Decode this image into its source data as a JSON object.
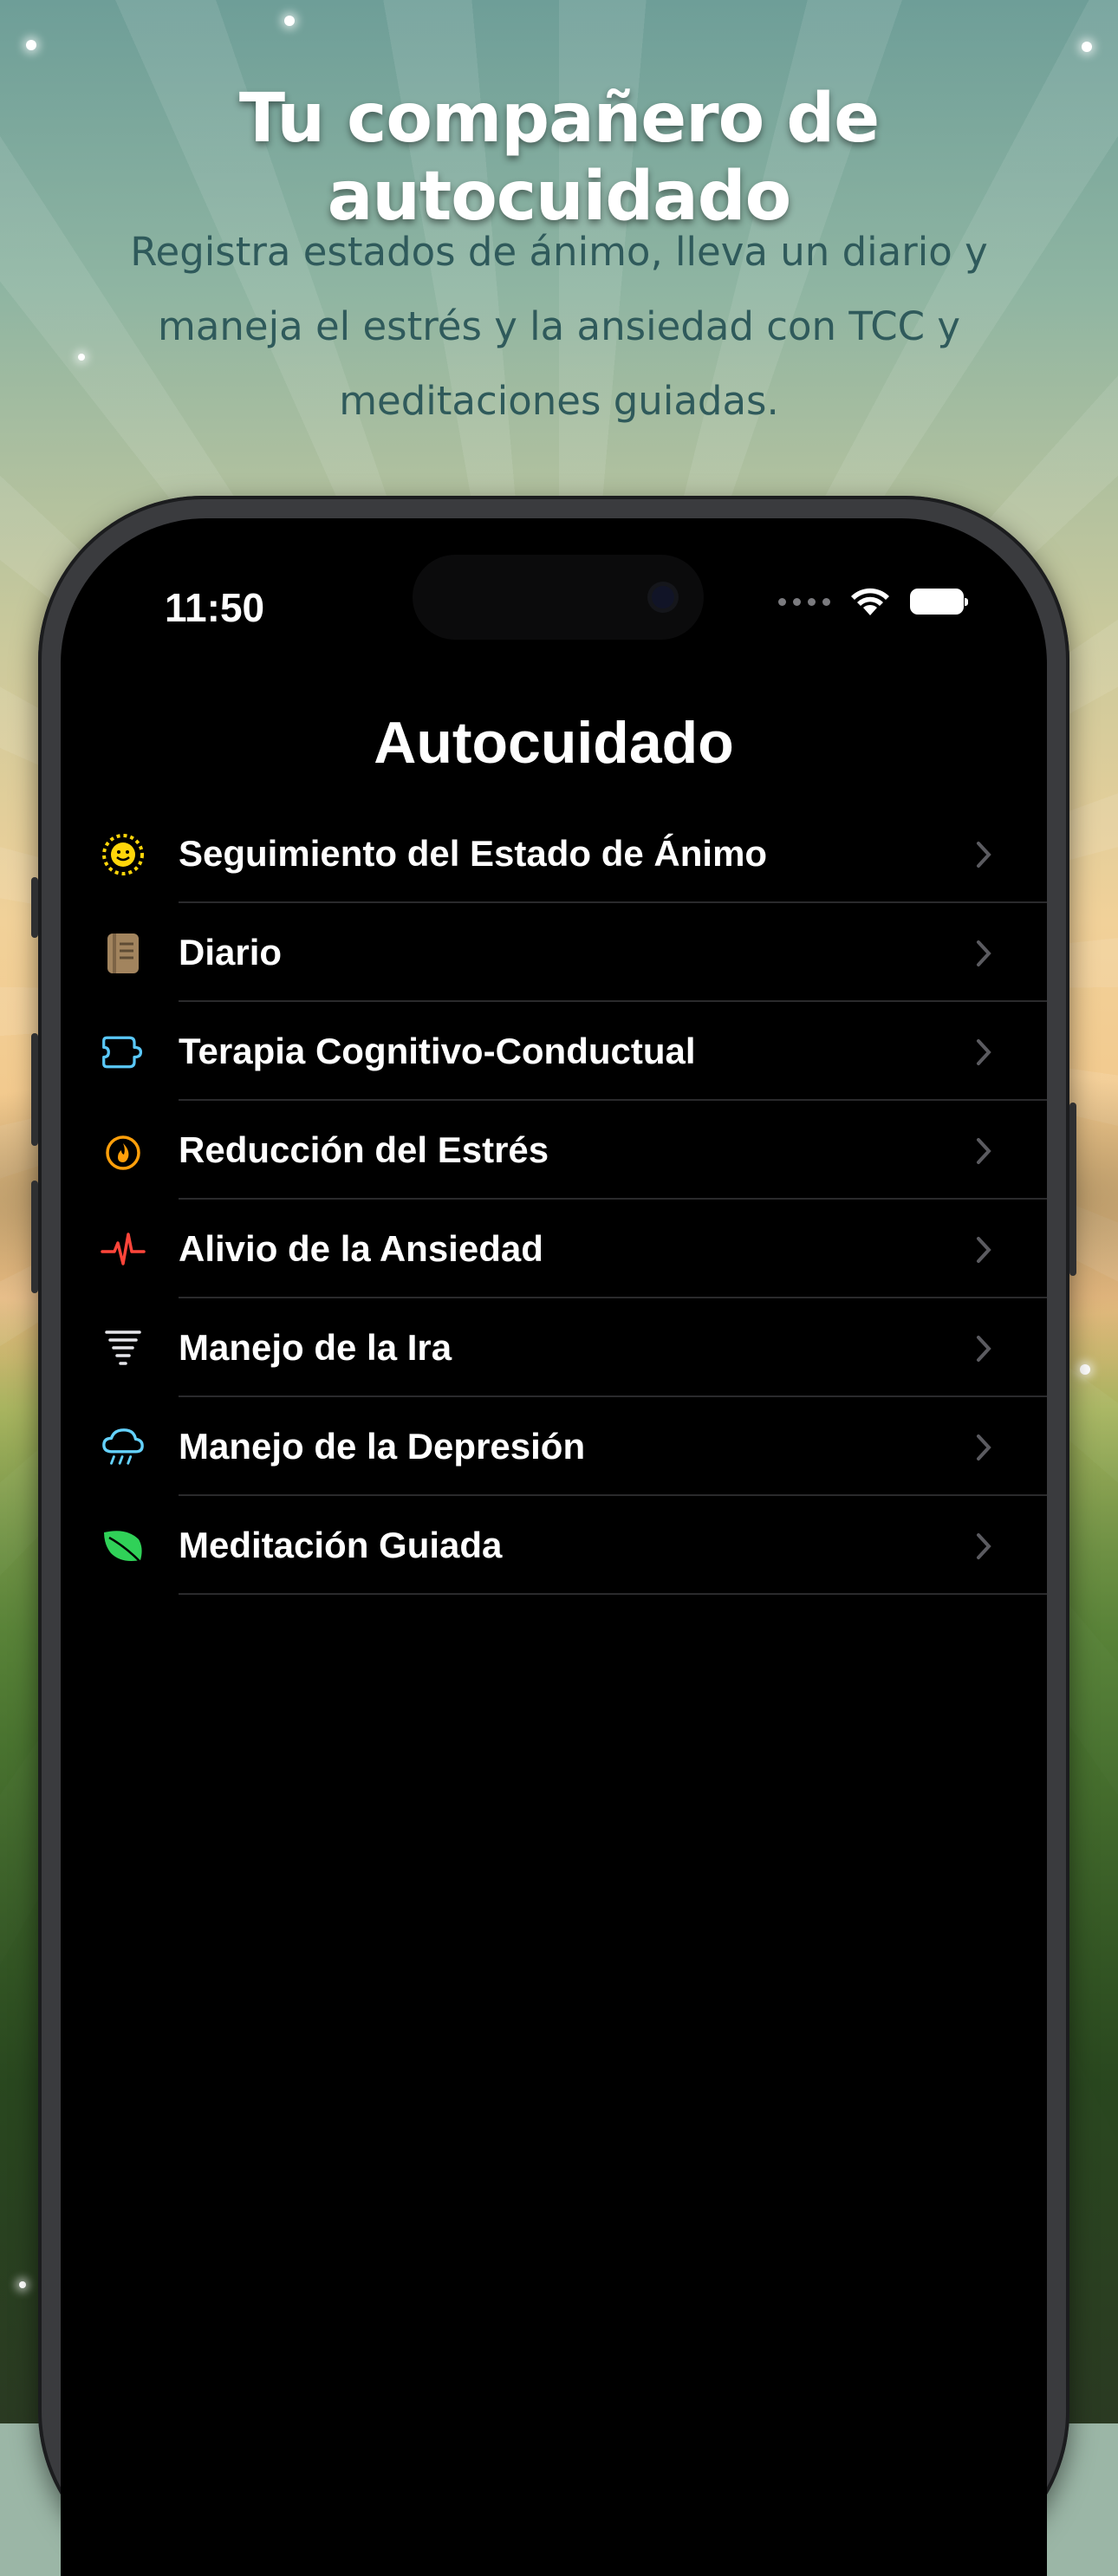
{
  "promo": {
    "headline": "Tu compañero de autocuidado",
    "subhead": "Registra estados de ánimo, lleva un diario y maneja el estrés y la ansiedad con TCC y meditaciones guiadas."
  },
  "status_bar": {
    "time": "11:50",
    "icons": [
      "signal-dots-icon",
      "wifi-icon",
      "battery-icon"
    ]
  },
  "screen": {
    "title": "Autocuidado",
    "items": [
      {
        "label": "Seguimiento del Estado de Ánimo",
        "icon": "smiley-sun-icon",
        "color": "#FFD60A"
      },
      {
        "label": "Diario",
        "icon": "journal-icon",
        "color": "#A2845E"
      },
      {
        "label": "Terapia Cognitivo-Conductual",
        "icon": "brain-head-icon",
        "color": "#5AC8FA"
      },
      {
        "label": "Reducción del Estrés",
        "icon": "flame-icon",
        "color": "#FF9F0A"
      },
      {
        "label": "Alivio de la Ansiedad",
        "icon": "heartbeat-icon",
        "color": "#FF453A"
      },
      {
        "label": "Manejo de la Ira",
        "icon": "tornado-icon",
        "color": "#E5E5EA"
      },
      {
        "label": "Manejo de la Depresión",
        "icon": "rain-cloud-icon",
        "color": "#64D2FF"
      },
      {
        "label": "Meditación Guiada",
        "icon": "leaf-icon",
        "color": "#30D158"
      }
    ]
  }
}
